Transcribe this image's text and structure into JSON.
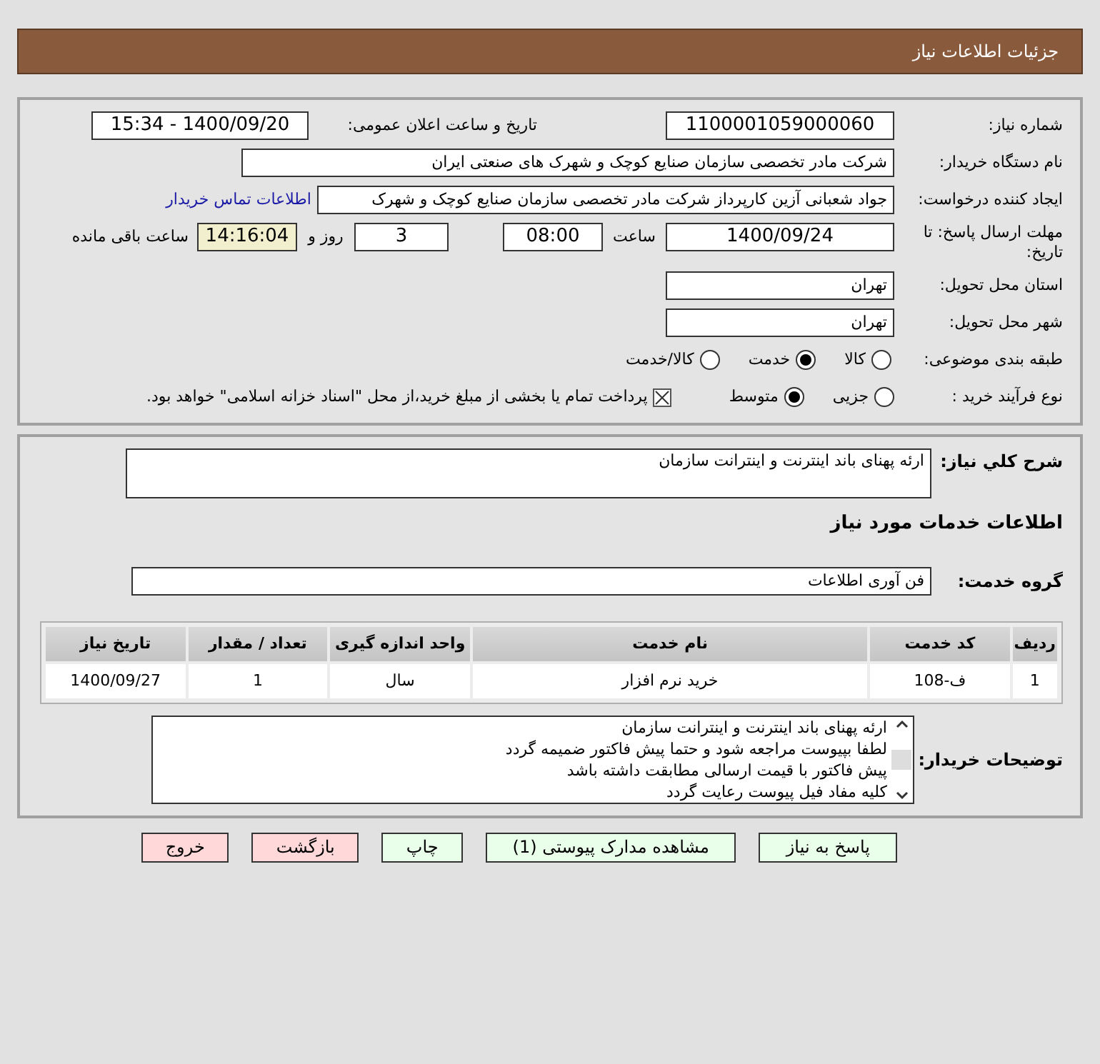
{
  "header": {
    "title": "جزئیات اطلاعات نیاز"
  },
  "info": {
    "need_number": {
      "label": "شماره نیاز:",
      "value": "1100001059000060"
    },
    "announce": {
      "label": "تاریخ و ساعت اعلان عمومی:",
      "value": "1400/09/20 - 15:34"
    },
    "buyer": {
      "label": "نام دستگاه خریدار:",
      "value": "شرکت مادر تخصصی سازمان صنایع کوچک و شهرک های صنعتی ایران"
    },
    "creator": {
      "label": "ایجاد کننده درخواست:",
      "value": "جواد  شعبانی آزین کارپرداز  شرکت مادر تخصصی سازمان صنایع کوچک و شهرک",
      "link": "اطلاعات تماس خریدار"
    },
    "deadline": {
      "label": "مهلت ارسال پاسخ: تا تاریخ:",
      "date": "1400/09/24",
      "time_label": "ساعت",
      "time": "08:00",
      "days": "3",
      "days_label": "روز و",
      "remaining": "14:16:04",
      "remaining_label": "ساعت باقی مانده"
    },
    "province": {
      "label": "استان محل تحویل:",
      "value": "تهران"
    },
    "city": {
      "label": "شهر محل تحویل:",
      "value": "تهران"
    },
    "category": {
      "label": "طبقه بندی موضوعی:",
      "options": [
        {
          "label": "کالا",
          "selected": false
        },
        {
          "label": "خدمت",
          "selected": true
        },
        {
          "label": "کالا/خدمت",
          "selected": false
        }
      ]
    },
    "process": {
      "label": "نوع فرآیند خرید :",
      "options": [
        {
          "label": "جزیی",
          "selected": false
        },
        {
          "label": "متوسط",
          "selected": true
        }
      ],
      "treasury": {
        "checked": true,
        "label": "پرداخت تمام یا بخشی از مبلغ خرید،از محل \"اسناد خزانه اسلامی\" خواهد بود."
      }
    }
  },
  "details": {
    "summary": {
      "label": "شرح کلي نیاز:",
      "value": "ارئه پهنای باند اینترنت و اینترانت سازمان"
    },
    "section_title": "اطلاعات خدمات مورد نیاز",
    "group": {
      "label": "گروه خدمت:",
      "value": "فن آوری اطلاعات"
    },
    "table": {
      "columns": [
        "ردیف",
        "کد خدمت",
        "نام خدمت",
        "واحد اندازه گیری",
        "تعداد / مقدار",
        "تاریخ نیاز"
      ],
      "rows": [
        [
          "1",
          "ف-108",
          "خرید نرم افزار",
          "سال",
          "1",
          "1400/09/27"
        ]
      ]
    },
    "notes": {
      "label": "توضیحات خریدار:",
      "lines": [
        "ارئه پهنای باند اینترنت و اینترانت سازمان",
        "لطفا بپیوست مراجعه شود و حتما پیش فاکتور ضمیمه گردد",
        "پیش فاکتور با قیمت ارسالی مطابقت داشته باشد",
        "کلیه مفاد فیل پیوست رعایت گردد"
      ]
    }
  },
  "buttons": [
    {
      "label": "پاسخ به نیاز",
      "kind": "normal"
    },
    {
      "label": "مشاهده مدارک پیوستی (1)",
      "kind": "normal"
    },
    {
      "label": "چاپ",
      "kind": "normal"
    },
    {
      "label": "بازگشت",
      "kind": "danger"
    },
    {
      "label": "خروج",
      "kind": "danger"
    }
  ]
}
